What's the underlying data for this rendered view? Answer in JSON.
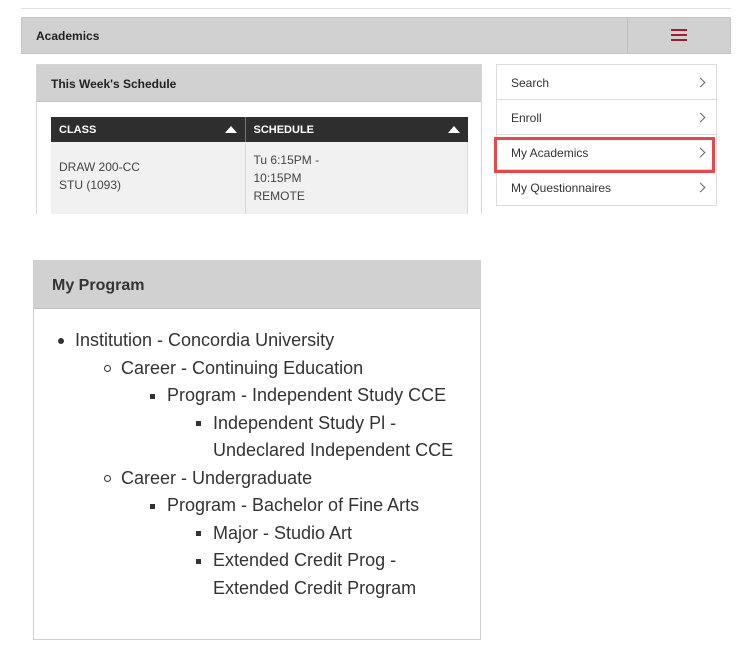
{
  "academics": {
    "title": "Academics",
    "menu_icon": "hamburger-icon",
    "accent_color": "#a6192e"
  },
  "schedule": {
    "title": "This Week's Schedule",
    "columns": [
      "CLASS",
      "SCHEDULE"
    ],
    "rows": [
      {
        "class_line1": "DRAW 200-CC",
        "class_line2": "STU (1093)",
        "time_line1": "Tu 6:15PM -",
        "time_line2": "10:15PM",
        "location": "REMOTE"
      }
    ]
  },
  "nav": {
    "items": [
      {
        "label": "Search"
      },
      {
        "label": "Enroll"
      },
      {
        "label": "My Academics"
      },
      {
        "label": "My Questionnaires"
      }
    ],
    "highlight_color": "#e8474b"
  },
  "program": {
    "title": "My Program",
    "institution": "Institution - Concordia University",
    "career1": "Career - Continuing Education",
    "program1": "Program - Independent Study CCE",
    "plan1_line1": "Independent Study Pl -",
    "plan1_line2": "Undeclared Independent CCE",
    "career2": "Career - Undergraduate",
    "program2": "Program - Bachelor of Fine Arts",
    "plan2": "Major - Studio Art",
    "plan3_line1": "Extended Credit Prog -",
    "plan3_line2": "Extended Credit Program"
  }
}
